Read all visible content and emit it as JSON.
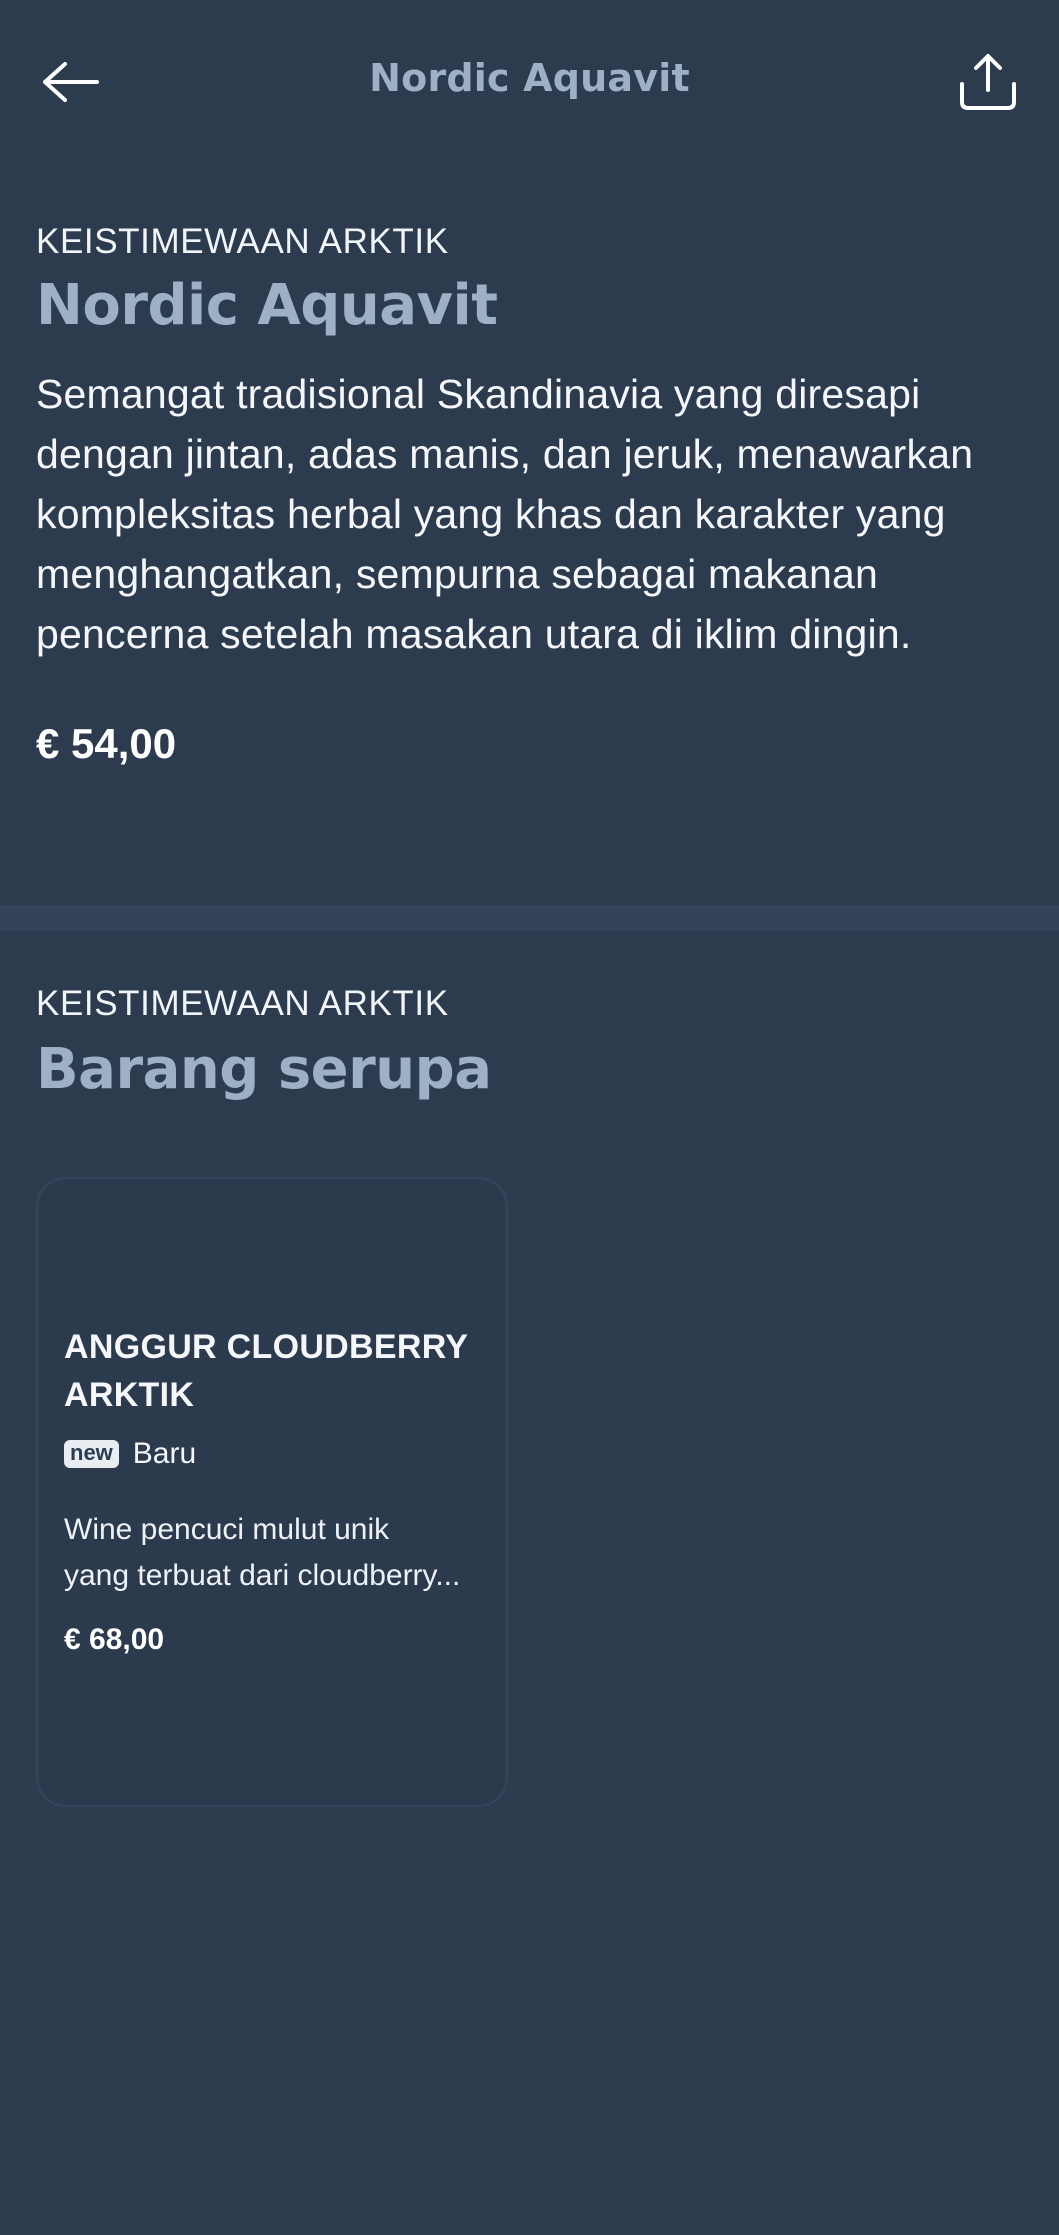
{
  "header": {
    "title": "Nordic Aquavit",
    "back_icon": "arrow-left-icon",
    "share_icon": "share-icon"
  },
  "product": {
    "category": "KEISTIMEWAAN ARKTIK",
    "name": "Nordic Aquavit",
    "description": "Semangat tradisional Skandinavia yang diresapi dengan jintan, adas manis, dan jeruk, menawarkan kompleksitas herbal yang khas dan karakter yang menghangatkan, sempurna sebagai makanan pencerna setelah masakan utara di iklim dingin.",
    "price": "€ 54,00"
  },
  "similar": {
    "category": "KEISTIMEWAAN ARKTIK",
    "heading": "Barang serupa",
    "items": [
      {
        "name": "ANGGUR CLOUDBERRY ARKTIK",
        "badge": "new",
        "badge_label": "Baru",
        "description_line1": "Wine pencuci mulut unik",
        "description_line2": "yang terbuat dari cloudberry...",
        "price": "€ 68,00"
      }
    ]
  },
  "colors": {
    "background": "#2d3b4e",
    "accent_heading": "#9eb0c6",
    "divider": "#34435a"
  }
}
